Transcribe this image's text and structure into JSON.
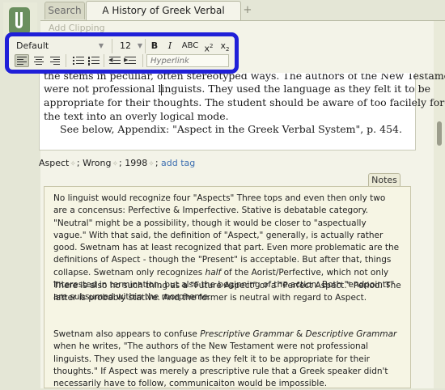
{
  "tabs": [
    {
      "label": "Search",
      "active": false
    },
    {
      "label": "A History of Greek Verbal Description",
      "active": true
    }
  ],
  "tab_add_label": "+",
  "add_clipping_label": "Add Clipping",
  "toolbar": {
    "font_family": "Default",
    "font_size": "12",
    "bold_label": "B",
    "italic_label": "I",
    "smallcaps_label": "ABC",
    "superscript_base": "x",
    "superscript_mark": "2",
    "subscript_base": "x",
    "subscript_mark": "2",
    "hyperlink_placeholder": "Hyperlink",
    "highlight_color": "#1f1fd8"
  },
  "document": {
    "lines": [
      "the stems in peculiar, often stereotyped ways. The authors of the New Testament",
      "were not professional linguists. They used the language as they felt it to be",
      "appropriate for their thoughts. The student should be aware of too facilely forcing",
      "the text into an overly logical mode.",
      "See below, Appendix: \"Aspect in the Greek Verbal System\", p. 454."
    ]
  },
  "tags": {
    "items": [
      "Aspect",
      "Wrong",
      "1998"
    ],
    "separator": ";",
    "add_label": "add tag"
  },
  "notes": {
    "tab_label": "Notes",
    "p1": "No linguist would recognize four \"Aspects\" Three tops and even then only two are a concensus: Perfective & Imperfective. Stative is debatable category. \"Neutral\" might be a possibility, though it would be closer to \"aspectually vague.\" With that said, the definition of \"Aspect,\" generally, is actually rather good. Swetnam has at least recognized that part. Even more problematic are the definitions of Aspect - though the \"Present\" is acceptable. But after that, things collapse. Swetnam only recognizes",
    "p1_em": "half",
    "p1_tail": "of the Aorist/Perfective, which not only interested in termination, but also the beginning of the action. Both \"endpoints\" are subsumed within the morpheme.",
    "p2": "There is also no such thing as a \"Future Aspect\" or a \"Perfect Aspect.\" Period. The latter is probably stative. And the former is neutral with regard to Aspect.",
    "p3_a": "Swetnam also appears to confuse",
    "p3_em1": "Prescriptive Grammar",
    "p3_amp": "&",
    "p3_em2": "Descriptive Grammar",
    "p3_b": "when he writes, \"The authors of the New Testament were not professional linguists. They used the language as they felt it to be appropriate for their thoughts.\" If Aspect was merely a prescriptive rule that a Greek speaker didn't necessarily have to follow, communicaiton would be impossible."
  }
}
